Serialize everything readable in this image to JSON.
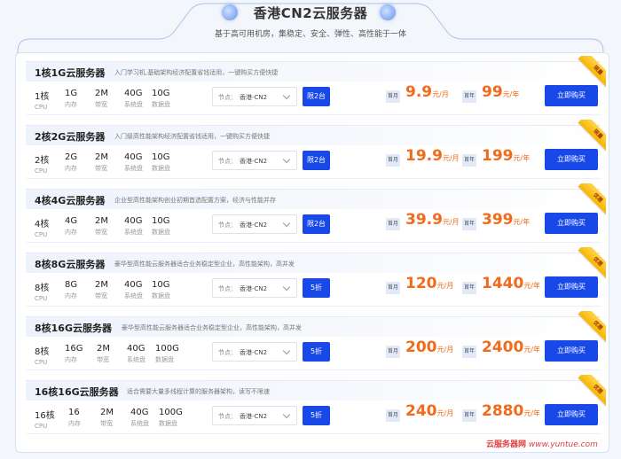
{
  "header": {
    "title": "香港CN2云服务器",
    "subtitle": "基于高可用机房，集稳定、安全、弹性、高性能于一体"
  },
  "labels": {
    "cpu": "CPU",
    "ram": "内存",
    "bw": "带宽",
    "sys": "系统盘",
    "data": "数据盘",
    "node": "节点：",
    "monthly": "首月",
    "yearly": "首年",
    "buy": "立即购买"
  },
  "cards": [
    {
      "title": "1核1G云服务器",
      "desc": "入门学习机,基础架构经济配置省钱适用，一键购买方便快捷",
      "cpu": "1核",
      "ram": "1G",
      "bw": "2M",
      "sys": "40G",
      "data": "10G",
      "node": "香港-CN2",
      "tag": "限2台",
      "month_price": "9.9",
      "month_unit": "元/月",
      "year_price": "99",
      "year_unit": "元/年",
      "ribbon": "限量"
    },
    {
      "title": "2核2G云服务器",
      "desc": "入门级高性能架构经济配置省钱适用，一键购买方便快捷",
      "cpu": "2核",
      "ram": "2G",
      "bw": "2M",
      "sys": "40G",
      "data": "10G",
      "node": "香港-CN2",
      "tag": "限2台",
      "month_price": "19.9",
      "month_unit": "元/月",
      "year_price": "199",
      "year_unit": "元/年",
      "ribbon": "限量"
    },
    {
      "title": "4核4G云服务器",
      "desc": "企业型高性能架构创业初期首选配置方案，经济与性能并存",
      "cpu": "4核",
      "ram": "4G",
      "bw": "2M",
      "sys": "40G",
      "data": "10G",
      "node": "香港-CN2",
      "tag": "限2台",
      "month_price": "39.9",
      "month_unit": "元/月",
      "year_price": "399",
      "year_unit": "元/年",
      "ribbon": "优惠"
    },
    {
      "title": "8核8G云服务器",
      "desc": "豪华型高性能云服务器适合业务稳定型企业，高性能架构，高并发",
      "cpu": "8核",
      "ram": "8G",
      "bw": "2M",
      "sys": "40G",
      "data": "10G",
      "node": "香港-CN2",
      "tag": "5折",
      "month_price": "120",
      "month_unit": "元/月",
      "year_price": "1440",
      "year_unit": "元/年",
      "ribbon": "优惠"
    },
    {
      "title": "8核16G云服务器",
      "desc": "豪华型高性能云服务器适合业务稳定型企业，高性能架构，高并发",
      "cpu": "8核",
      "ram": "16G",
      "bw": "2M",
      "sys": "40G",
      "data": "100G",
      "node": "香港-CN2",
      "tag": "5折",
      "month_price": "200",
      "month_unit": "元/月",
      "year_price": "2400",
      "year_unit": "元/年",
      "ribbon": "优惠"
    },
    {
      "title": "16核16G云服务器",
      "desc": "适合需要大量多线程计算的服务器架构，读写不限速",
      "cpu": "16核",
      "ram": "16",
      "bw": "2M",
      "sys": "40G",
      "data": "100G",
      "node": "香港-CN2",
      "tag": "5折",
      "month_price": "240",
      "month_unit": "元/月",
      "year_price": "2880",
      "year_unit": "元/年",
      "ribbon": "优惠"
    }
  ],
  "watermark": {
    "brand": "云服务器网",
    "url": "www.yuntue.com"
  },
  "colors": {
    "accent": "#1848e8",
    "price": "#f26a1b",
    "ribbon": "#f5b400"
  }
}
